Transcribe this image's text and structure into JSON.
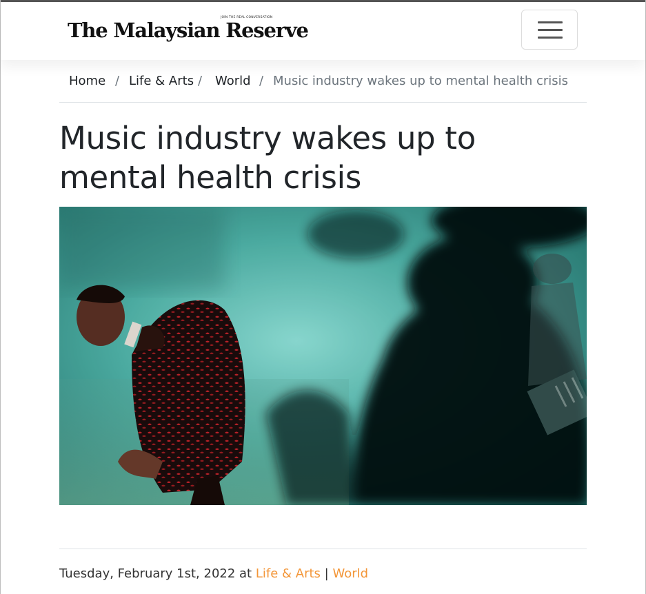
{
  "site": {
    "logo_text": "The Malaysian Reserve",
    "logo_tagline": "JOIN THE REAL CONVERSATION"
  },
  "navbar": {
    "menu_icon": "hamburger-menu-icon"
  },
  "breadcrumb": {
    "items": [
      "Home",
      "Life & Arts",
      "World"
    ],
    "separator": "/",
    "current": "Music industry wakes up to mental health crisis"
  },
  "article": {
    "title": "Music industry wakes up to mental health crisis",
    "date_text": "Tuesday, February 1st, 2022 at",
    "categories": [
      "Life & Arts",
      "World"
    ],
    "category_separator": "|"
  },
  "colors": {
    "accent": "#f39638",
    "text": "#212529",
    "muted": "#6c757d"
  }
}
